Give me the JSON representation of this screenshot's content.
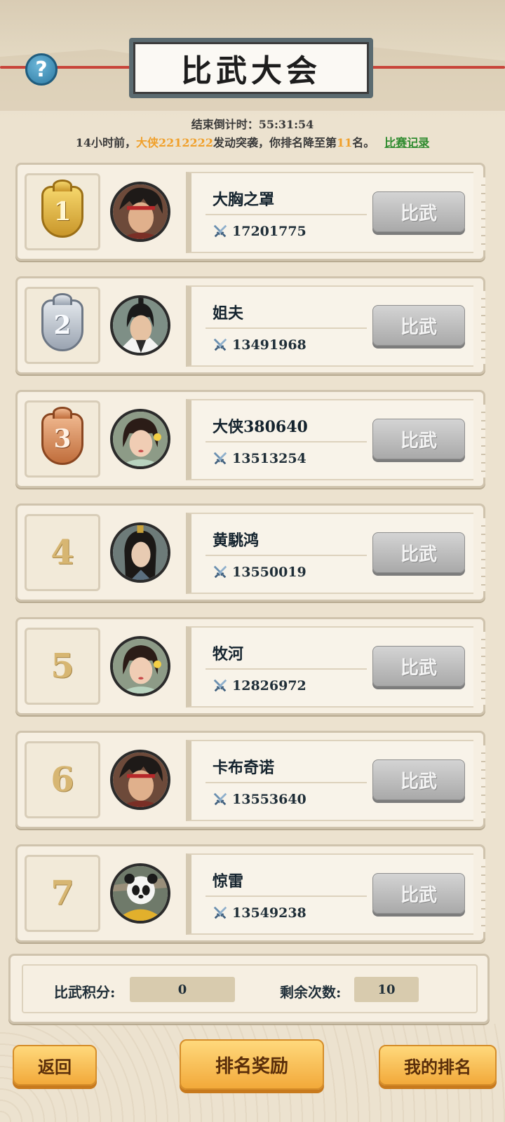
{
  "header": {
    "help_symbol": "?",
    "title": "比武大会",
    "countdown": "结束倒计时：55:31:54",
    "notice": {
      "prefix": "14小时前，",
      "attacker": "大侠2212222",
      "middle": "发动突袭，你排名降至第",
      "rank": "11",
      "suffix": "名。",
      "link_label": "比赛记录"
    }
  },
  "colors": {
    "highlight": "#f0a02b",
    "link": "#2e8b2e",
    "button_orange": "#f2a93a",
    "button_gray": "#a9a9a9"
  },
  "ranking": [
    {
      "rank": "1",
      "medal": "gold",
      "name": "大胸之罩",
      "power": "17201775",
      "button": "比武",
      "avatar": "warrior-headband"
    },
    {
      "rank": "2",
      "medal": "silver",
      "name": "姐夫",
      "power": "13491968",
      "button": "比武",
      "avatar": "swordsman-white"
    },
    {
      "rank": "3",
      "medal": "bronze",
      "name": "大侠380640",
      "power": "13513254",
      "button": "比武",
      "avatar": "heroine-flower"
    },
    {
      "rank": "4",
      "medal": "",
      "name": "黄駣鸿",
      "power": "13550019",
      "button": "比武",
      "avatar": "scholar-long-hair"
    },
    {
      "rank": "5",
      "medal": "",
      "name": "牧河",
      "power": "12826972",
      "button": "比武",
      "avatar": "heroine-flower"
    },
    {
      "rank": "6",
      "medal": "",
      "name": "卡布奇诺",
      "power": "13553640",
      "button": "比武",
      "avatar": "warrior-headband"
    },
    {
      "rank": "7",
      "medal": "",
      "name": "惊雷",
      "power": "13549238",
      "button": "比武",
      "avatar": "panda"
    }
  ],
  "stats": {
    "score_label": "比武积分:",
    "score_value": "0",
    "remaining_label": "剩余次数:",
    "remaining_value": "10"
  },
  "footer": {
    "back_label": "返回",
    "reward_label": "排名奖励",
    "my_rank_label": "我的排名"
  },
  "icons": {
    "help": "question-icon",
    "power": "crossed-swords-icon"
  }
}
